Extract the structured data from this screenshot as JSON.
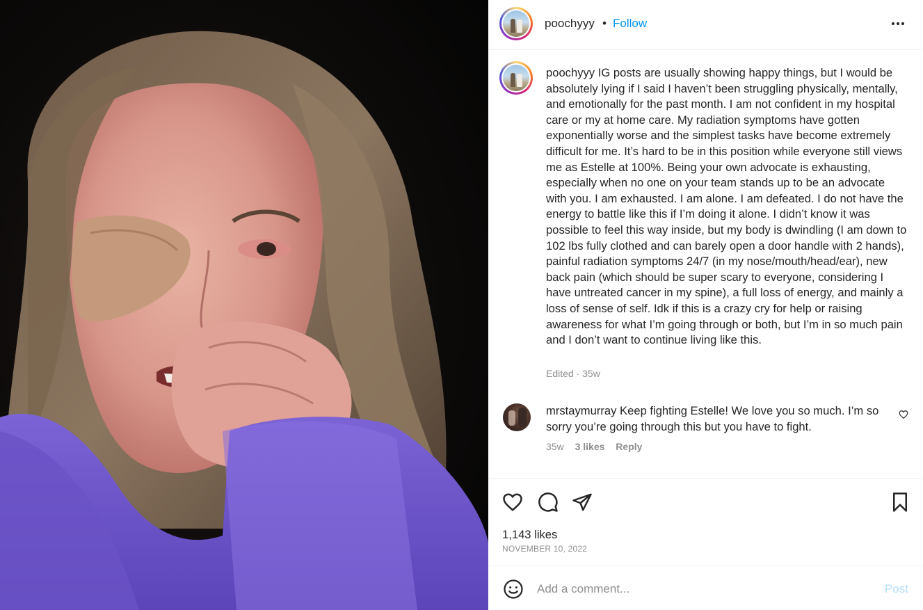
{
  "post": {
    "username": "poochyyy",
    "separator": "•",
    "follow_label": "Follow",
    "caption": "IG posts are usually showing happy things, but I would be absolutely lying if I said I haven’t been struggling physically, mentally, and emotionally for the past month. I am not confident in my hospital care or my at home care. My radiation symptoms have gotten exponentially worse and the simplest tasks have become extremely difficult for me. It’s hard to be in this position while everyone still views me as Estelle at 100%. Being your own advocate is exhausting, especially when no one on your team stands up to be an advocate with you. I am exhausted. I am alone. I am defeated. I do not have the energy to battle like this if I’m doing it alone. I didn’t know it was possible to feel this way inside, but my body is dwindling (I am down to 102 lbs fully clothed and can barely open a door handle with 2 hands), painful radiation symptoms 24/7 (in my nose/mouth/head/ear), new back pain (which should be super scary to everyone, considering I have untreated cancer in my spine), a full loss of energy, and mainly a loss of sense of self. Idk if this is a crazy cry for help or raising awareness for what I’m going through or both, but I’m in so much pain and I don’t want to continue living like this.",
    "caption_meta": "Edited · 35w",
    "likes": "1,143 likes",
    "date": "NOVEMBER 10, 2022"
  },
  "comment": {
    "username": "mrstaymurray",
    "text": "Keep fighting Estelle! We love you so much. I’m so sorry you’re going through this but you have to fight.",
    "time": "35w",
    "likes": "3 likes",
    "reply_label": "Reply"
  },
  "add_comment": {
    "placeholder": "Add a comment...",
    "post_label": "Post"
  },
  "icons": {
    "more": "more-options-icon",
    "like": "heart-icon",
    "comment": "comment-icon",
    "share": "share-icon",
    "save": "bookmark-icon",
    "emoji": "emoji-icon"
  },
  "colors": {
    "link": "#0095f6",
    "post_disabled": "#b2dffc",
    "muted": "#8e8e8e"
  }
}
